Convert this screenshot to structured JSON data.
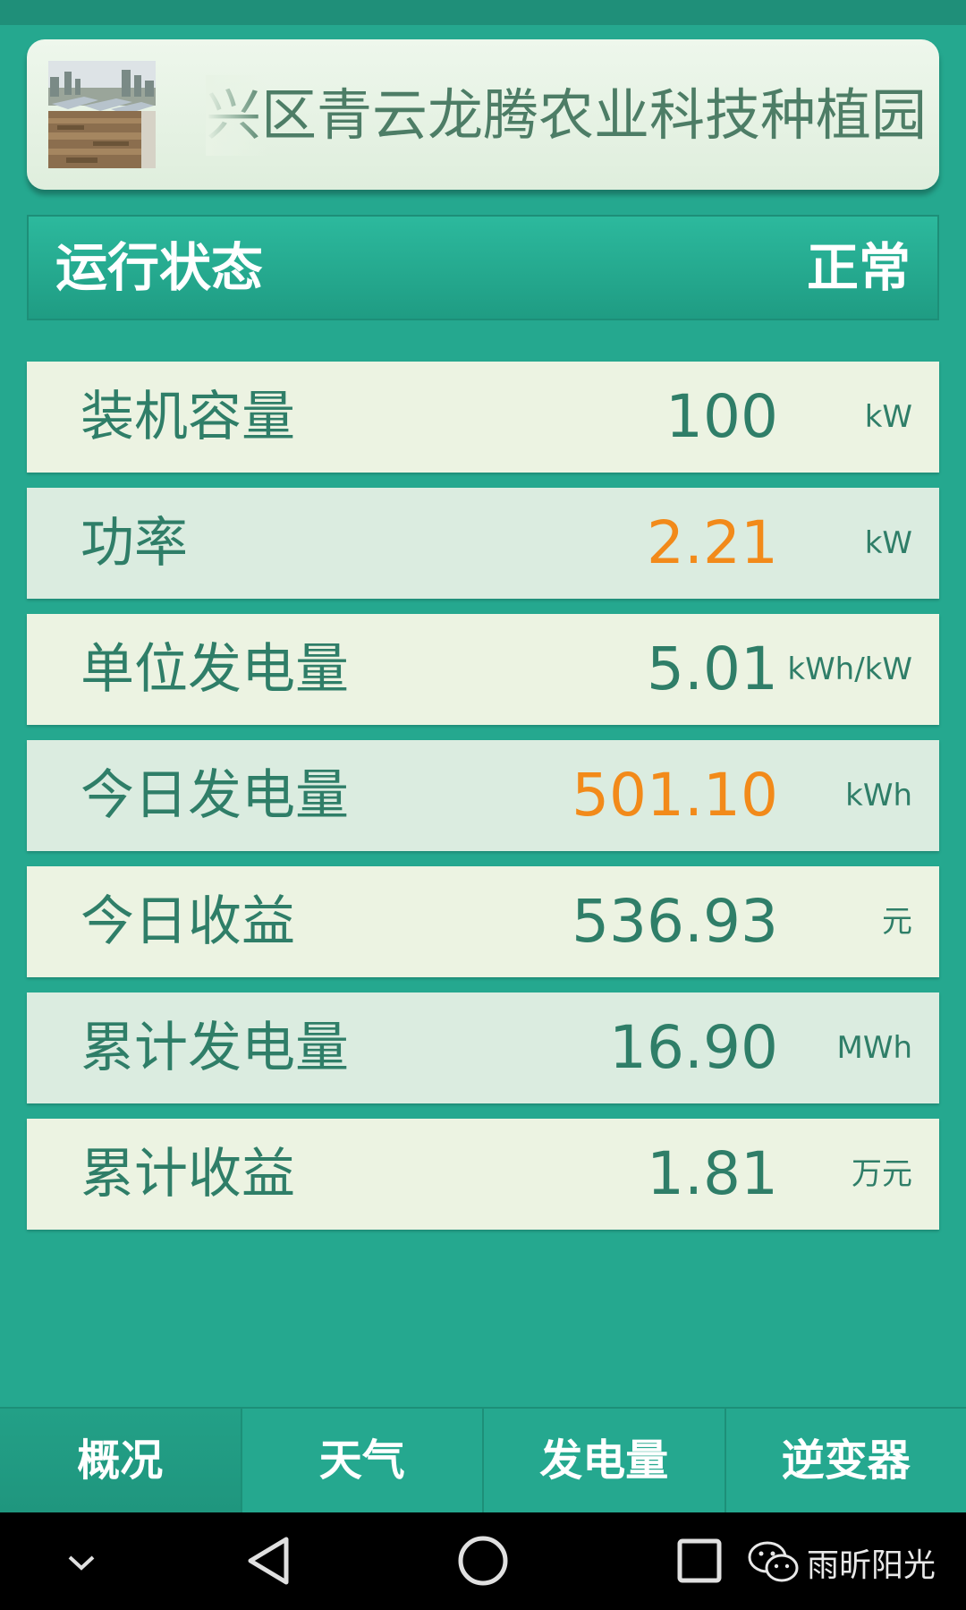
{
  "header": {
    "station_name": "兴区青云龙腾农业科技种植园"
  },
  "status": {
    "label": "运行状态",
    "value": "正常"
  },
  "metrics": [
    {
      "label": "装机容量",
      "value": "100",
      "unit": "kW",
      "accent": false
    },
    {
      "label": "功率",
      "value": "2.21",
      "unit": "kW",
      "accent": true
    },
    {
      "label": "单位发电量",
      "value": "5.01",
      "unit": "kWh/kW",
      "accent": false
    },
    {
      "label": "今日发电量",
      "value": "501.10",
      "unit": "kWh",
      "accent": true
    },
    {
      "label": "今日收益",
      "value": "536.93",
      "unit": "元",
      "accent": false
    },
    {
      "label": "累计发电量",
      "value": "16.90",
      "unit": "MWh",
      "accent": false
    },
    {
      "label": "累计收益",
      "value": "1.81",
      "unit": "万元",
      "accent": false
    }
  ],
  "tabs": [
    {
      "label": "概况",
      "active": true
    },
    {
      "label": "天气",
      "active": false
    },
    {
      "label": "发电量",
      "active": false
    },
    {
      "label": "逆变器",
      "active": false
    }
  ],
  "watermark": {
    "text": "雨昕阳光",
    "icon": "wechat-icon"
  },
  "colors": {
    "background": "#25a88f",
    "accent": "#f28a1a",
    "text": "#2f7e68"
  }
}
